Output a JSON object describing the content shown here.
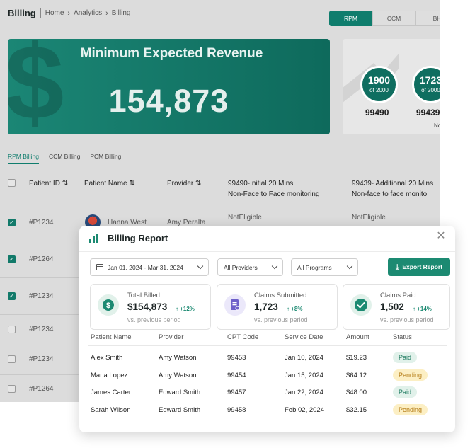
{
  "page": {
    "title": "Billing",
    "breadcrumb": [
      "Home",
      "Analytics",
      "Billing"
    ],
    "program_tabs": [
      "RPM",
      "CCM",
      "BH"
    ]
  },
  "hero": {
    "title": "Minimum Expected Revenue",
    "value": "154,873"
  },
  "stats": [
    {
      "count": "1900",
      "of": "of 2000",
      "code": "99490"
    },
    {
      "count": "1723",
      "of": "of 2000",
      "code": "99439"
    }
  ],
  "stats_note": "No",
  "billing_tabs": [
    "RPM Billing",
    "CCM Billing",
    "PCM Billing"
  ],
  "table": {
    "headers": {
      "patient_id": "Patient ID",
      "patient_name": "Patient Name",
      "provider": "Provider",
      "col_99490_line1": "99490-Initial 20 Mins",
      "col_99490_line2": "Non-Face to Face monitoring",
      "col_99439_line1": "99439- Additional 20 Mins",
      "col_99439_line2": "Non-face to face monito"
    },
    "sort_icon": "⇅",
    "rows": [
      {
        "id": "#P1234",
        "name": "Hanna West",
        "provider": "Amy Peralta",
        "c1": "NotEligible",
        "c2": "NotEligible",
        "checked": true
      },
      {
        "id": "#P1264",
        "checked": true
      },
      {
        "id": "#P1234",
        "checked": true
      },
      {
        "id": "#P1234",
        "checked": false
      },
      {
        "id": "#P1234",
        "checked": false
      },
      {
        "id": "#P1264",
        "checked": false
      }
    ]
  },
  "report": {
    "title": "Billing Report",
    "close_icon": "close-icon",
    "filters": {
      "date_range": "Jan 01, 2024 - Mar 31, 2024",
      "providers": "All Providers",
      "programs": "All Programs"
    },
    "export_label": "Export Report",
    "kpis": [
      {
        "label": "Total Billed",
        "value": "$154,873",
        "change": "↑ +12%",
        "sub": "vs. previous period",
        "icon": "dollar-icon",
        "color": "#1c8a72"
      },
      {
        "label": "Claims Submitted",
        "value": "1,723",
        "change": "↑ +8%",
        "sub": "vs. previous period",
        "icon": "document-icon",
        "color": "#6d5fc9"
      },
      {
        "label": "Claims Paid",
        "value": "1,502",
        "change": "↑ +14%",
        "sub": "vs. previous period",
        "icon": "check-icon",
        "color": "#1c8a72"
      }
    ],
    "columns": {
      "patient": "Patient Name",
      "provider": "Provider",
      "cpt": "CPT Code",
      "date": "Service Date",
      "amount": "Amount",
      "status": "Status"
    },
    "rows": [
      {
        "patient": "Alex Smith",
        "provider": "Amy Watson",
        "cpt": "99453",
        "date": "Jan 10, 2024",
        "amount": "$19.23",
        "status": "Paid"
      },
      {
        "patient": "Maria Lopez",
        "provider": "Amy Watson",
        "cpt": "99454",
        "date": "Jan 15, 2024",
        "amount": "$64.12",
        "status": "Pending"
      },
      {
        "patient": "James Carter",
        "provider": "Edward Smith",
        "cpt": "99457",
        "date": "Jan 22, 2024",
        "amount": "$48.00",
        "status": "Paid"
      },
      {
        "patient": "Sarah Wilson",
        "provider": "Edward Smith",
        "cpt": "99458",
        "date": "Feb 02, 2024",
        "amount": "$32.15",
        "status": "Pending"
      }
    ]
  },
  "colors": {
    "accent": "#1c8a72",
    "paid_bg": "#e1f1ea",
    "pending_bg": "#fcefc4"
  }
}
